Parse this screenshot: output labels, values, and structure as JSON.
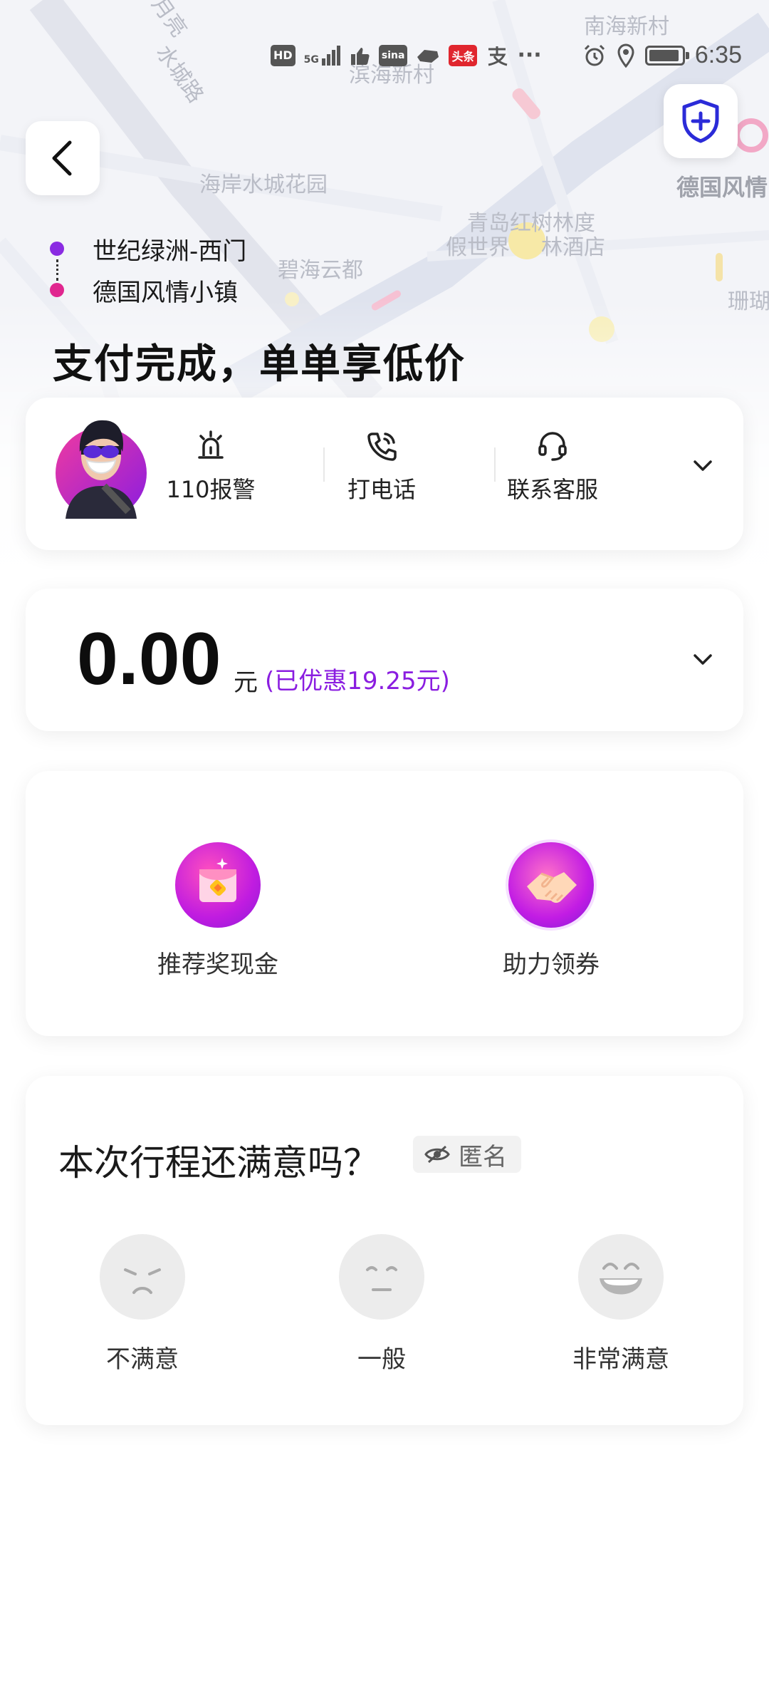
{
  "map": {
    "labels": [
      "南海新村",
      "滨海新村",
      "海岸水城花园",
      "德国风情",
      "青岛红树林度",
      "假世界",
      "林酒店",
      "碧海云都",
      "水城路",
      "月亮",
      "珊瑚"
    ]
  },
  "status_bar": {
    "hd": "HD",
    "net": "5G",
    "news_badge": "头条",
    "more": "···",
    "time": "6:35"
  },
  "route": {
    "start": "世纪绿洲-西门",
    "end": "德国风情小镇",
    "start_color": "#8a2be2",
    "end_color": "#e0268f"
  },
  "headline": "支付完成，单单享低价",
  "driver_actions": [
    {
      "label": "110报警",
      "icon": "alarm-siren-icon"
    },
    {
      "label": "打电话",
      "icon": "phone-icon"
    },
    {
      "label": "联系客服",
      "icon": "headset-icon"
    }
  ],
  "price": {
    "amount": "0.00",
    "unit": "元",
    "discount": "(已优惠19.25元)"
  },
  "promos": [
    {
      "label": "推荐奖现金",
      "icon": "red-envelope-icon"
    },
    {
      "label": "助力领券",
      "icon": "handshake-icon"
    }
  ],
  "rating": {
    "title": "本次行程还满意吗？",
    "anonymous": "匿名",
    "options": [
      {
        "label": "不满意",
        "icon": "unhappy-face-icon"
      },
      {
        "label": "一般",
        "icon": "neutral-face-icon"
      },
      {
        "label": "非常满意",
        "icon": "very-happy-face-icon"
      }
    ]
  },
  "colors": {
    "accent_purple": "#8a1de0",
    "shield_blue": "#2b2bd8"
  }
}
